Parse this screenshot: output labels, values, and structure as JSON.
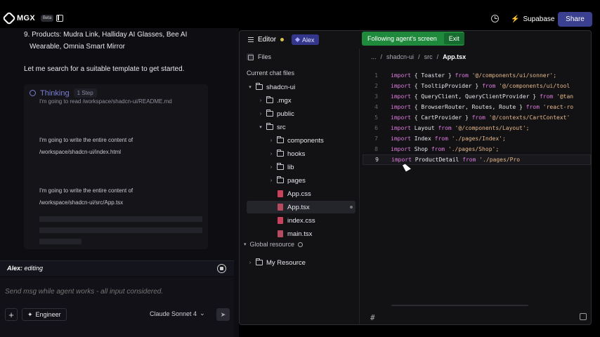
{
  "header": {
    "logo_text": "MGX",
    "beta": "Beta",
    "supabase_label": "Supabase",
    "share_label": "Share"
  },
  "chat": {
    "list_item_number": "9.",
    "list_item_text": "Products: Mudra Link, Halliday AI Glasses, Bee AI Wearable, Omnia Smart Mirror",
    "message": "Let me search for a suitable template to get started.",
    "thinking": {
      "title": "Thinking",
      "badge": "1 Step",
      "log_partial": "I'm going to read /workspace/shadcn-ui/README.md",
      "log1_line1": "I'm going to write the entire content of",
      "log1_line2": "/workspace/shadcn-ui/index.html",
      "log2_line1": "I'm going to write the entire content of",
      "log2_line2": "/workspace/shadcn-ui/src/App.tsx"
    },
    "editing_user": "Alex:",
    "editing_status": "editing",
    "input_placeholder": "Send msg while agent works - all input considered.",
    "plus": "+",
    "engineer_label": "Engineer",
    "model_label": "Claude Sonnet 4",
    "model_caret": "⌄",
    "send_icon": "➤"
  },
  "editor": {
    "title": "Editor",
    "user_chip": "Alex",
    "following_text": "Following agent's screen",
    "exit_label": "Exit",
    "files_label": "Files",
    "breadcrumb": [
      "...",
      "/",
      "shadcn-ui",
      "/",
      "src",
      "/",
      "App.tsx"
    ],
    "tree_title": "Current chat files",
    "tree": [
      {
        "label": "shadcn-ui",
        "type": "folder",
        "depth": 0,
        "open": true
      },
      {
        "label": ".mgx",
        "type": "folder",
        "depth": 1,
        "open": false
      },
      {
        "label": "public",
        "type": "folder",
        "depth": 1,
        "open": false
      },
      {
        "label": "src",
        "type": "folder",
        "depth": 1,
        "open": true
      },
      {
        "label": "components",
        "type": "folder",
        "depth": 2,
        "open": false
      },
      {
        "label": "hooks",
        "type": "folder",
        "depth": 2,
        "open": false
      },
      {
        "label": "lib",
        "type": "folder",
        "depth": 2,
        "open": false
      },
      {
        "label": "pages",
        "type": "folder",
        "depth": 2,
        "open": false
      },
      {
        "label": "App.css",
        "type": "css",
        "depth": 2
      },
      {
        "label": "App.tsx",
        "type": "tsx",
        "depth": 2,
        "selected": true
      },
      {
        "label": "index.css",
        "type": "css",
        "depth": 2
      },
      {
        "label": "main.tsx",
        "type": "tsx",
        "depth": 2
      }
    ],
    "global_resource": "Global resource",
    "my_resource": "My Resource",
    "code": [
      {
        "n": "1",
        "kw": "import",
        "id": " { Toaster } ",
        "from": "from",
        "str": " '@/components/ui/sonner';"
      },
      {
        "n": "2",
        "kw": "import",
        "id": " { TooltipProvider } ",
        "from": "from",
        "str": " '@/components/ui/tool"
      },
      {
        "n": "3",
        "kw": "import",
        "id": " { QueryClient, QueryClientProvider } ",
        "from": "from",
        "str": " '@tan"
      },
      {
        "n": "4",
        "kw": "import",
        "id": " { BrowserRouter, Routes, Route } ",
        "from": "from",
        "str": " 'react-ro"
      },
      {
        "n": "5",
        "kw": "import",
        "id": " { CartProvider } ",
        "from": "from",
        "str": " '@/contexts/CartContext'"
      },
      {
        "n": "6",
        "kw": "import",
        "id": " Layout ",
        "from": "from",
        "str": " '@/components/Layout';"
      },
      {
        "n": "7",
        "kw": "import",
        "id": " Index ",
        "from": "from",
        "str": " './pages/Index';"
      },
      {
        "n": "8",
        "kw": "import",
        "id": " Shop ",
        "from": "from",
        "str": " './pages/Shop';"
      },
      {
        "n": "9",
        "kw": "import",
        "id": " ProductDetail ",
        "from": "from",
        "str": " './pages/Pro"
      }
    ],
    "hash": "#"
  }
}
